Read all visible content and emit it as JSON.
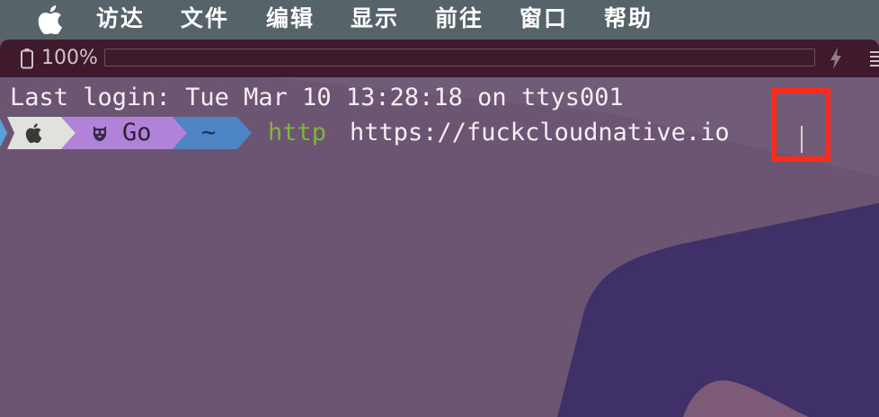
{
  "menubar": {
    "items": [
      "访达",
      "文件",
      "编辑",
      "显示",
      "前往",
      "窗口",
      "帮助"
    ]
  },
  "statusbar": {
    "battery": "100%"
  },
  "terminal": {
    "last_login": "Last login: Tue Mar 10 13:28:18 on ttys001",
    "prompt": {
      "segment_os": "apple-icon",
      "segment_lang": "Go",
      "segment_dir": "~"
    },
    "command": {
      "program": "http",
      "argument": "https://fuckcloudnative.io"
    }
  },
  "colors": {
    "menubar_bg": "#56646a",
    "statusbar_bg": "#3e1a2c",
    "terminal_bg": "#6b5573",
    "seg_os": "#e2e2dc",
    "seg_lang": "#b083d8",
    "seg_dir": "#4c84c4",
    "cmd_green": "#7fb53a",
    "highlight": "#ff2a1a"
  }
}
